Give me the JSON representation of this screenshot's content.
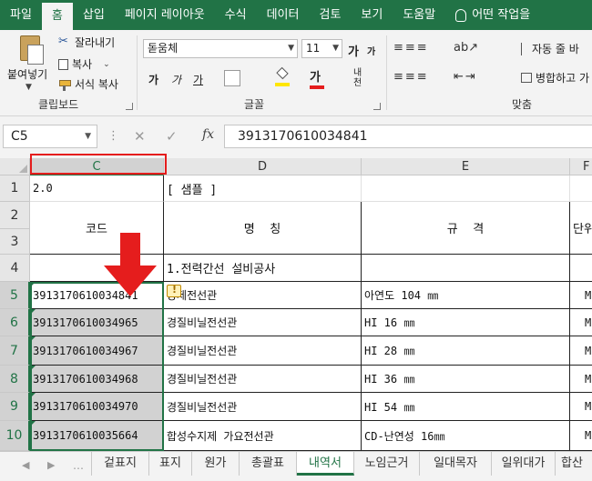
{
  "menu": {
    "tabs": [
      "파일",
      "홈",
      "삽입",
      "페이지 레이아웃",
      "수식",
      "데이터",
      "검토",
      "보기",
      "도움말"
    ],
    "active": "홈",
    "tell_me": "어떤 작업을"
  },
  "ribbon": {
    "clipboard": {
      "paste": "붙여넣기",
      "cut": "잘라내기",
      "copy": "복사",
      "format_painter": "서식 복사",
      "label": "클립보드"
    },
    "font": {
      "font_name": "돋움체",
      "font_size": "11",
      "grow": "가",
      "shrink": "가",
      "bold": "가",
      "italic": "가",
      "underline": "가",
      "phonetic": "내천",
      "label": "글꼴"
    },
    "alignment": {
      "wrap_text": "자동 줄 바",
      "merge": "병합하고 가",
      "label": "맞춤"
    }
  },
  "formula_bar": {
    "name_box": "C5",
    "fx": "fx",
    "value": "3913170610034841"
  },
  "columns": [
    "C",
    "D",
    "E",
    "F"
  ],
  "selected_column": "C",
  "rows": [
    {
      "n": "1",
      "c": "2.0",
      "d": "[ 샘플 ]",
      "e": "",
      "f": ""
    },
    {
      "n": "2",
      "c": "코드",
      "d": "명    칭",
      "e": "규    격",
      "f": "단위"
    },
    {
      "n": "3",
      "c": "",
      "d": "",
      "e": "",
      "f": ""
    },
    {
      "n": "4",
      "c": "",
      "d": "1.전력간선 설비공사",
      "e": "",
      "f": ""
    },
    {
      "n": "5",
      "c": "3913170610034841",
      "d": "강제전선관",
      "e": "아연도 104 ㎜",
      "f": "M"
    },
    {
      "n": "6",
      "c": "3913170610034965",
      "d": "경질비닐전선관",
      "e": "HI 16 ㎜",
      "f": "M"
    },
    {
      "n": "7",
      "c": "3913170610034967",
      "d": "경질비닐전선관",
      "e": "HI 28 ㎜",
      "f": "M"
    },
    {
      "n": "8",
      "c": "3913170610034968",
      "d": "경질비닐전선관",
      "e": "HI 36 ㎜",
      "f": "M"
    },
    {
      "n": "9",
      "c": "3913170610034970",
      "d": "경질비닐전선관",
      "e": "HI 54 ㎜",
      "f": "M"
    },
    {
      "n": "10",
      "c": "3913170610035664",
      "d": "합성수지제 가요전선관",
      "e": "CD-난연성 16㎜",
      "f": "M"
    }
  ],
  "sheets": [
    "겉표지",
    "표지",
    "원가",
    "총괄표",
    "내역서",
    "노임근거",
    "일대목자",
    "일위대가",
    "합산"
  ],
  "active_sheet": "내역서",
  "colors": {
    "accent": "#217346",
    "annotation": "#e51d1d",
    "selection": "#d2d2d2"
  }
}
